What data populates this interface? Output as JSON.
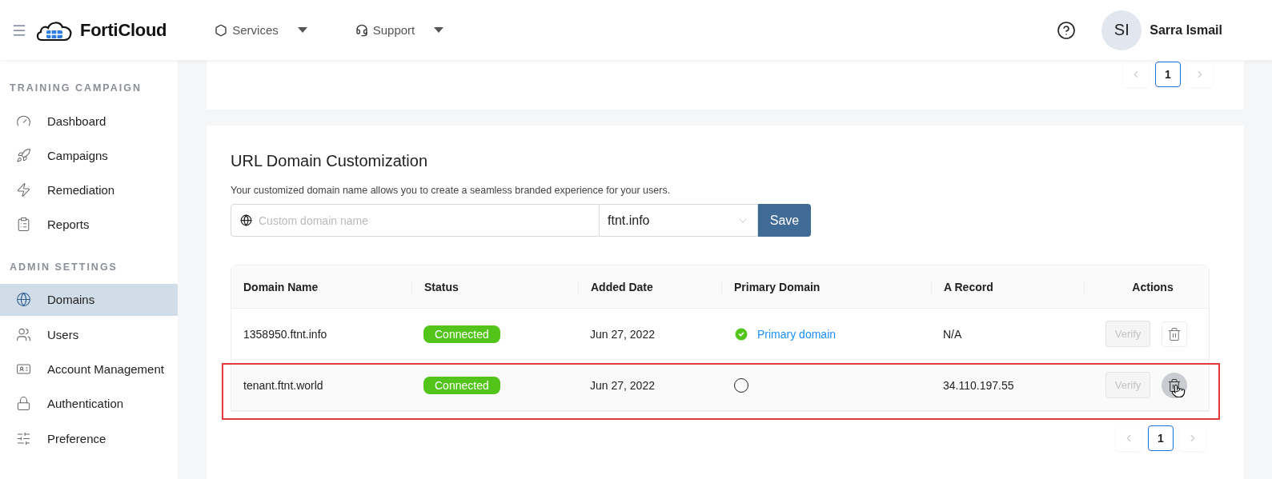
{
  "header": {
    "brand": "FortiCloud",
    "menus": [
      {
        "label": "Services",
        "kind": "services"
      },
      {
        "label": "Support",
        "kind": "support"
      }
    ],
    "user": {
      "initials": "SI",
      "name": "Sarra Ismail"
    }
  },
  "sidebar": {
    "sections": [
      {
        "title": "TRAINING CAMPAIGN",
        "items": [
          {
            "label": "Dashboard",
            "selected": false
          },
          {
            "label": "Campaigns",
            "selected": false
          },
          {
            "label": "Remediation",
            "selected": false
          },
          {
            "label": "Reports",
            "selected": false
          }
        ]
      },
      {
        "title": "ADMIN SETTINGS",
        "items": [
          {
            "label": "Domains",
            "selected": true
          },
          {
            "label": "Users",
            "selected": false
          },
          {
            "label": "Account Management",
            "selected": false
          },
          {
            "label": "Authentication",
            "selected": false
          },
          {
            "label": "Preference",
            "selected": false
          }
        ]
      }
    ]
  },
  "top_card": {
    "pagination": {
      "page": "1"
    }
  },
  "domain_card": {
    "title": "URL Domain Customization",
    "description": "Your customized domain name allows you to create a seamless branded experience for your users.",
    "domain_field": {
      "placeholder": "Custom domain name"
    },
    "suffix_select": {
      "value": "ftnt.info"
    },
    "save_button": "Save",
    "table": {
      "columns": [
        "Domain Name",
        "Status",
        "Added Date",
        "Primary Domain",
        "A Record",
        "Actions"
      ],
      "rows": [
        {
          "domain": "1358950.ftnt.info",
          "status": "Connected",
          "added": "Jun 27, 2022",
          "primary": true,
          "primary_label": "Primary domain",
          "a_record": "N/A",
          "verify": "Verify",
          "verify_disabled": true,
          "delete_hovered": false,
          "highlighted": false
        },
        {
          "domain": "tenant.ftnt.world",
          "status": "Connected",
          "added": "Jun 27, 2022",
          "primary": false,
          "a_record": "34.110.197.55",
          "verify": "Verify",
          "verify_disabled": true,
          "delete_hovered": true,
          "highlighted": true
        }
      ]
    },
    "pagination": {
      "page": "1"
    }
  }
}
